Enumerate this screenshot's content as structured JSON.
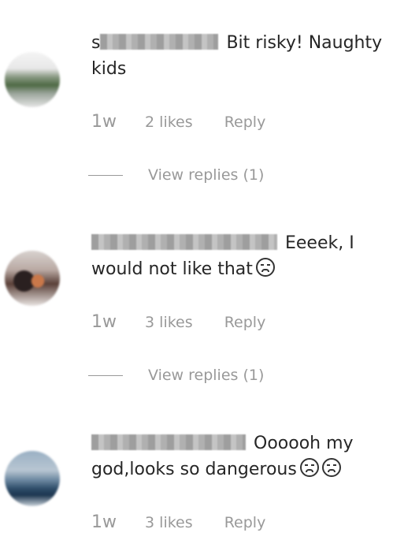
{
  "comments": [
    {
      "username_prefix": "s",
      "text": "Bit risky! Naughty kids",
      "time": "1w",
      "likes": "2 likes",
      "reply_label": "Reply",
      "view_replies": "View replies (1)"
    },
    {
      "username_prefix": "",
      "text": "Eeeek, I would not like that",
      "time": "1w",
      "likes": "3 likes",
      "reply_label": "Reply",
      "view_replies": "View replies (1)"
    },
    {
      "username_prefix": "",
      "text": "Oooooh my god,looks so dangerous",
      "time": "1w",
      "likes": "3 likes",
      "reply_label": "Reply"
    }
  ],
  "icons": {
    "emoji_2": "fearful-face-icon",
    "emoji_3a": "drooling-face-icon",
    "emoji_3b": "pensive-face-icon"
  }
}
